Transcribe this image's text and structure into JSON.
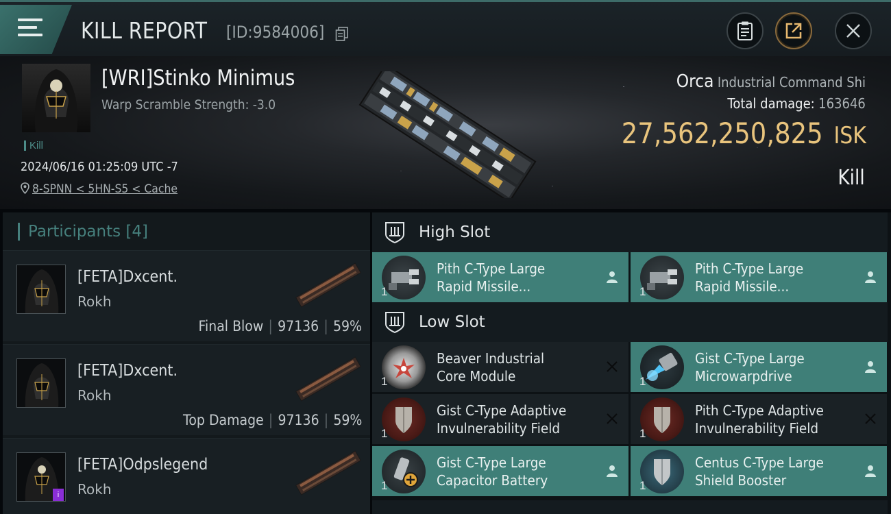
{
  "header": {
    "title": "KILL REPORT",
    "report_id": "[ID:9584006]"
  },
  "victim": {
    "name": "[WRI]Stinko Minimus",
    "warp_scramble": "Warp Scramble Strength: -3.0",
    "kill_tag": "Kill",
    "datetime": "2024/06/16 01:25:09 UTC -7",
    "location": "8-SPNN < 5HN-S5 < Cache",
    "ship_name": "Orca",
    "ship_class": "Industrial Command Shi",
    "total_damage_label": "Total damage:",
    "total_damage": "163646",
    "isk_value": "27,562,250,825",
    "isk_unit": "ISK",
    "result": "Kill"
  },
  "participants": {
    "title": "Participants",
    "count": "[4]",
    "rows": [
      {
        "name": "[FETA]Dxcent.",
        "ship": "Rokh",
        "role": "Final Blow",
        "damage": "97136",
        "percent": "59%"
      },
      {
        "name": "[FETA]Dxcent.",
        "ship": "Rokh",
        "role": "Top Damage",
        "damage": "97136",
        "percent": "59%"
      },
      {
        "name": "[FETA]Odpslegend",
        "ship": "Rokh",
        "badge": "i"
      }
    ]
  },
  "slots": {
    "high": {
      "label": "High Slot",
      "modules": [
        {
          "line1": "Pith C-Type Large",
          "line2": "Rapid Missile...",
          "qty": "1",
          "status": "dropped",
          "icon": "missile-launcher-icon"
        },
        {
          "line1": "Pith C-Type Large",
          "line2": "Rapid Missile...",
          "qty": "1",
          "status": "dropped",
          "icon": "missile-launcher-icon"
        }
      ]
    },
    "low": {
      "label": "Low Slot",
      "modules": [
        {
          "line1": "Beaver Industrial",
          "line2": "Core Module",
          "qty": "1",
          "status": "destroyed",
          "icon": "core-module-icon"
        },
        {
          "line1": "Gist C-Type Large",
          "line2": "Microwarpdrive",
          "qty": "1",
          "status": "dropped",
          "icon": "microwarpdrive-icon"
        },
        {
          "line1": "Gist C-Type Adaptive",
          "line2": "Invulnerability Field",
          "qty": "1",
          "status": "destroyed",
          "icon": "invulnerability-field-icon"
        },
        {
          "line1": "Pith C-Type Adaptive",
          "line2": "Invulnerability Field",
          "qty": "1",
          "status": "destroyed",
          "icon": "invulnerability-field-icon"
        },
        {
          "line1": "Gist C-Type Large",
          "line2": "Capacitor Battery",
          "qty": "1",
          "status": "dropped",
          "icon": "capacitor-battery-icon"
        },
        {
          "line1": "Centus C-Type Large",
          "line2": "Shield Booster",
          "qty": "1",
          "status": "dropped",
          "icon": "shield-booster-icon"
        }
      ]
    }
  },
  "colors": {
    "accent_teal": "#3f7f78",
    "isk_gold": "#e9c47d",
    "participants_teal": "#46807d",
    "badge_purple": "#8a2ed6"
  }
}
